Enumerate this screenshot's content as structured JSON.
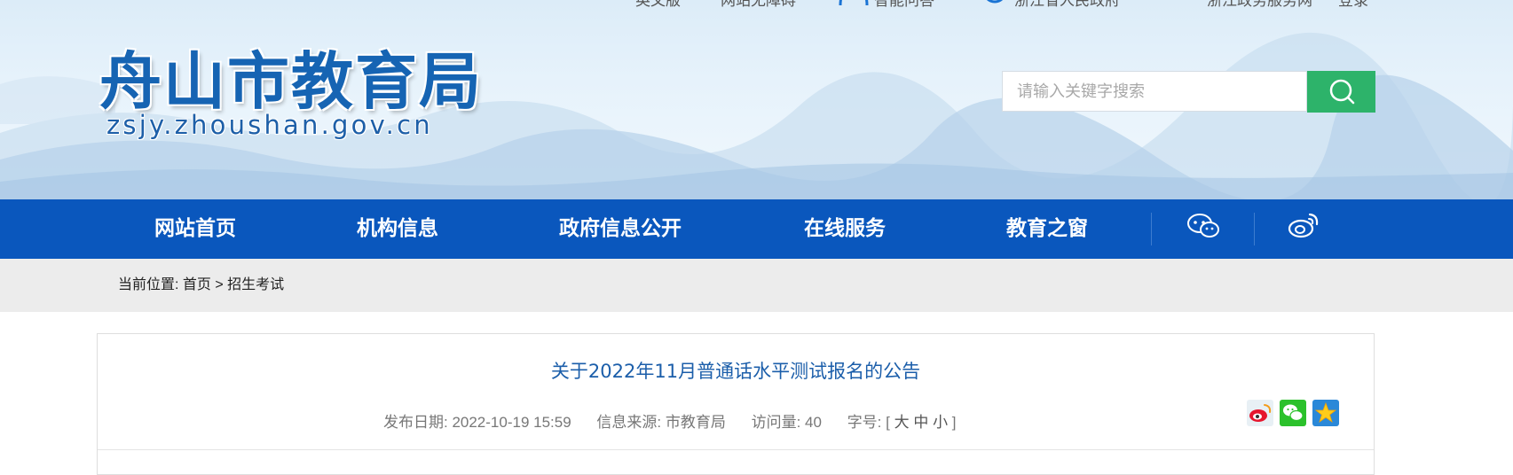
{
  "toplinks": {
    "english": "英文版",
    "accessible": "网站无障碍",
    "smart_qa": "智能问答",
    "zj_gov": "浙江省人民政府",
    "zj_service": "浙江政务服务网",
    "login": "登录"
  },
  "logo": {
    "title": "舟山市教育局",
    "domain": "zsjy.zhoushan.gov.cn"
  },
  "search": {
    "placeholder": "请输入关键字搜索",
    "value": ""
  },
  "nav": {
    "items": [
      "网站首页",
      "机构信息",
      "政府信息公开",
      "在线服务",
      "教育之窗"
    ],
    "icons": [
      "wechat-icon",
      "weibo-icon"
    ]
  },
  "breadcrumb": {
    "prefix": "当前位置: ",
    "home": "首页",
    "sep": " > ",
    "current": "招生考试"
  },
  "article": {
    "title": "关于2022年11月普通话水平测试报名的公告",
    "date": "发布日期: 2022-10-19 15:59",
    "source": "信息来源: 市教育局",
    "views": "访问量: 40",
    "font_label": "字号: [",
    "font_large": "大",
    "font_medium": "中",
    "font_small": "小",
    "font_close": "]",
    "share_icons": [
      "weibo-share-icon",
      "wechat-share-icon",
      "favorite-star-icon"
    ]
  },
  "colors": {
    "nav_bg": "#0a57bd",
    "search_btn": "#2db36a",
    "title_blue": "#1b5eaa",
    "logo_blue": "#1664b3"
  }
}
